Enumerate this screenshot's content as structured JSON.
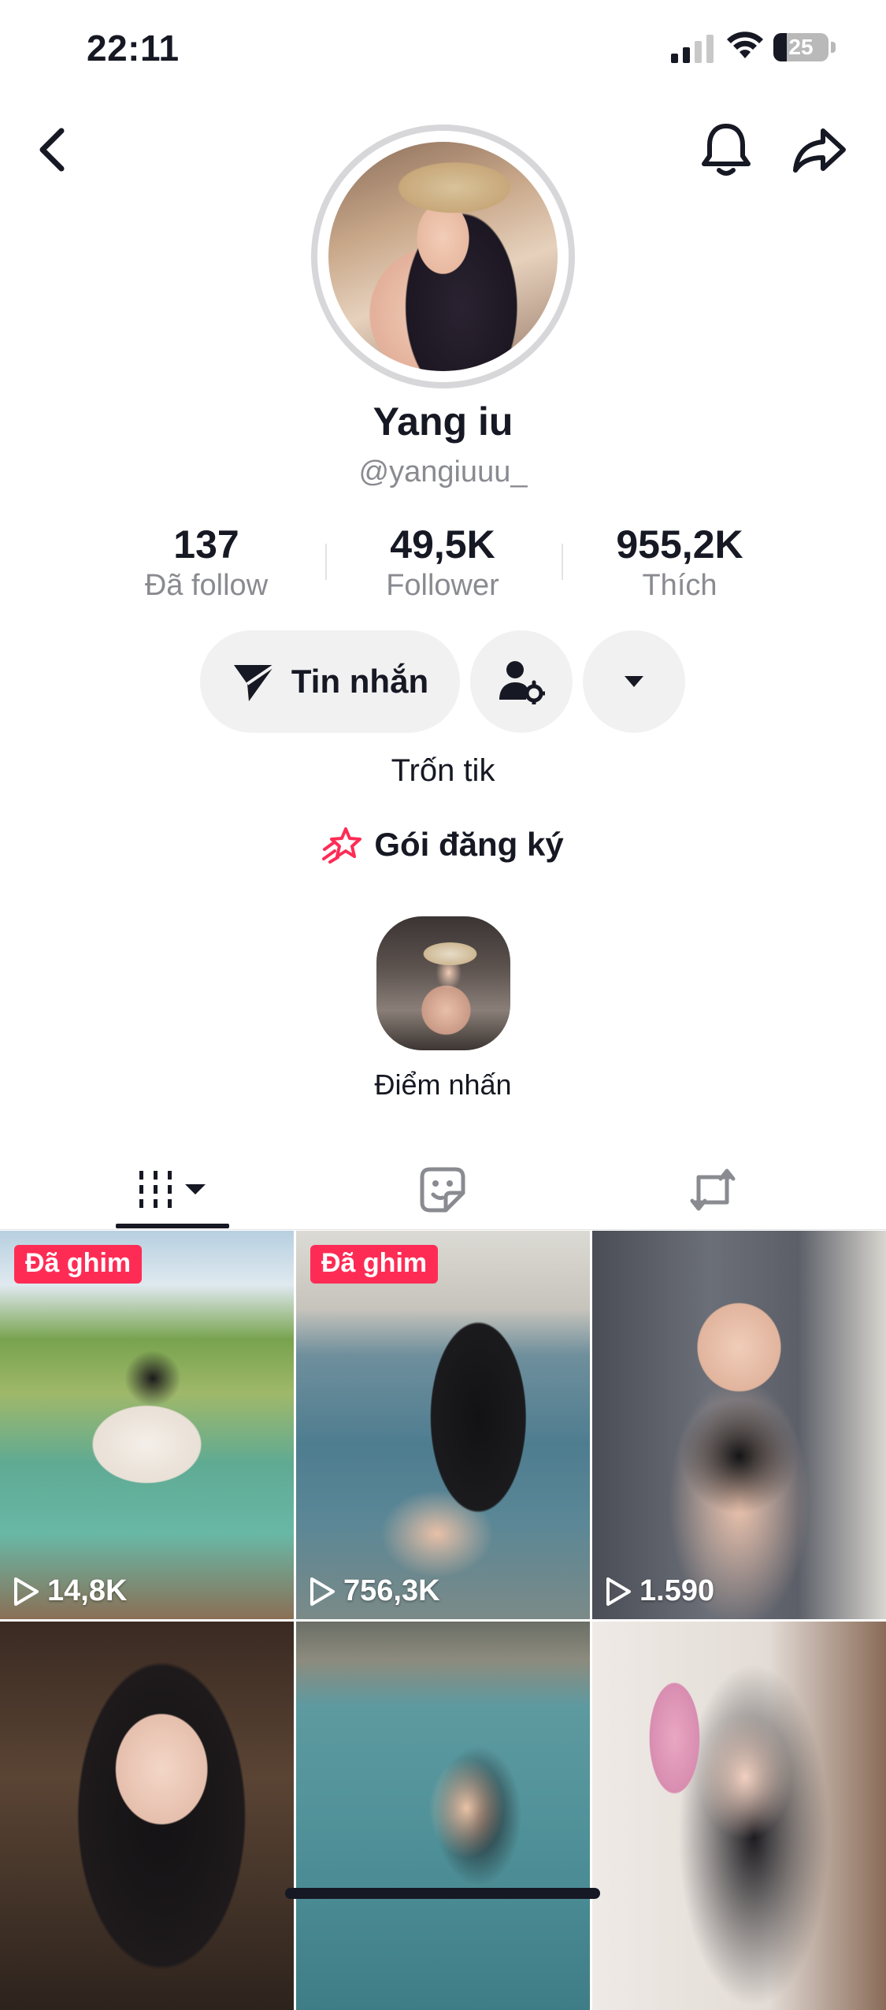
{
  "status_bar": {
    "time": "22:11",
    "battery": "25"
  },
  "profile": {
    "name": "Yang iu",
    "handle": "@yangiuuu_",
    "bio": "Trốn tik"
  },
  "stats": [
    {
      "value": "137",
      "label": "Đã follow"
    },
    {
      "value": "49,5K",
      "label": "Follower"
    },
    {
      "value": "955,2K",
      "label": "Thích"
    }
  ],
  "actions": {
    "message_label": "Tin nhắn"
  },
  "subscription": {
    "label": "Gói đăng ký"
  },
  "highlight": {
    "label": "Điểm nhấn"
  },
  "videos": [
    {
      "badge": "Đã ghim",
      "views": "14,8K"
    },
    {
      "badge": "Đã ghim",
      "views": "756,3K"
    },
    {
      "badge": "",
      "views": "1.590"
    },
    {
      "badge": "",
      "views": ""
    },
    {
      "badge": "",
      "views": ""
    },
    {
      "badge": "",
      "views": ""
    }
  ],
  "colors": {
    "accent": "#fe2c55",
    "text": "#161823",
    "muted": "#8a8b91",
    "pill": "#f1f1f2"
  },
  "icons": [
    "back-icon",
    "bell-icon",
    "share-icon",
    "send-icon",
    "add-friend-icon",
    "dropdown-icon",
    "subscription-star-icon",
    "grid-icon",
    "sticker-icon",
    "repost-icon",
    "play-icon"
  ]
}
